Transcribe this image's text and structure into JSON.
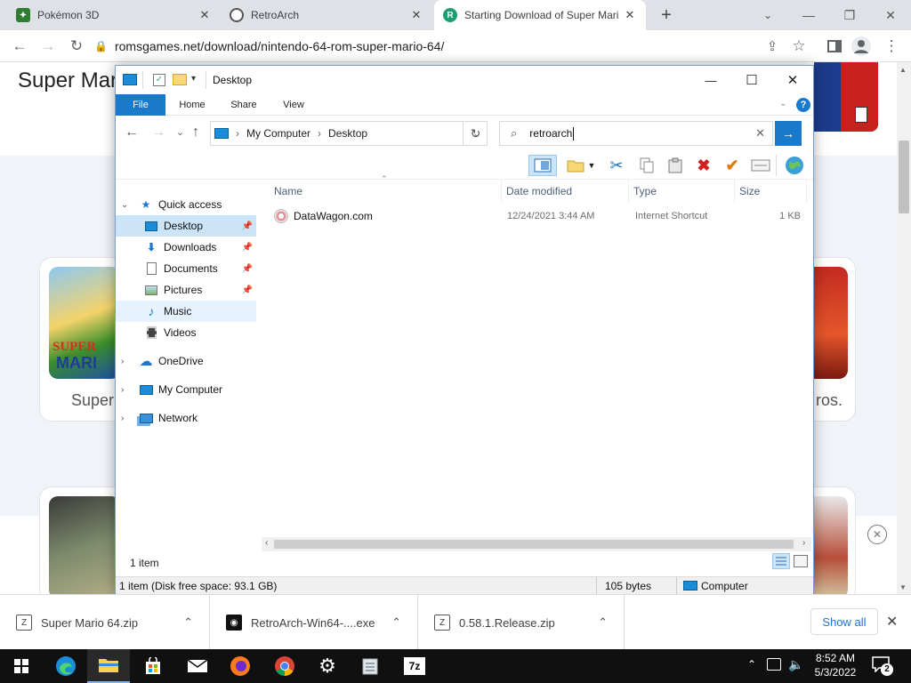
{
  "browser": {
    "tabs": [
      {
        "title": "Pokémon 3D",
        "close": "✕"
      },
      {
        "title": "RetroArch",
        "close": "✕"
      },
      {
        "title": "Starting Download of Super Mari",
        "close": "✕"
      }
    ],
    "new_tab": "+",
    "url": "romsgames.net/download/nintendo-64-rom-super-mario-64/",
    "window_controls": {
      "minimize": "—",
      "restore": "❐",
      "close": "✕"
    }
  },
  "page": {
    "heading": "Super Mar",
    "cards": [
      {
        "caption": "Super"
      },
      {
        "caption": "ros."
      }
    ]
  },
  "explorer": {
    "title": "Desktop",
    "ribbon_tabs": [
      "File",
      "Home",
      "Share",
      "View"
    ],
    "breadcrumb": [
      "My Computer",
      "Desktop"
    ],
    "search_value": "retroarch",
    "nav": {
      "quick_access": "Quick access",
      "items": [
        {
          "label": "Desktop",
          "pinned": true
        },
        {
          "label": "Downloads",
          "pinned": true
        },
        {
          "label": "Documents",
          "pinned": true
        },
        {
          "label": "Pictures",
          "pinned": true
        },
        {
          "label": "Music",
          "pinned": false
        },
        {
          "label": "Videos",
          "pinned": false
        }
      ],
      "onedrive": "OneDrive",
      "my_computer": "My Computer",
      "network": "Network"
    },
    "columns": [
      "Name",
      "Date modified",
      "Type",
      "Size"
    ],
    "files": [
      {
        "name": "DataWagon.com",
        "date": "12/24/2021 3:44 AM",
        "type": "Internet Shortcut",
        "size": "1 KB"
      }
    ],
    "item_count": "1 item",
    "status": {
      "disk": "1 item (Disk free space: 93.1 GB)",
      "bytes": "105 bytes",
      "location": "Computer"
    },
    "window_controls": {
      "minimize": "—",
      "maximize": "☐",
      "close": "✕"
    }
  },
  "downloads": {
    "items": [
      {
        "name": "Super Mario 64.zip"
      },
      {
        "name": "RetroArch-Win64-....exe"
      },
      {
        "name": "0.58.1.Release.zip"
      }
    ],
    "show_all": "Show all"
  },
  "taskbar": {
    "time": "8:52 AM",
    "date": "5/3/2022",
    "notification_count": "2"
  }
}
